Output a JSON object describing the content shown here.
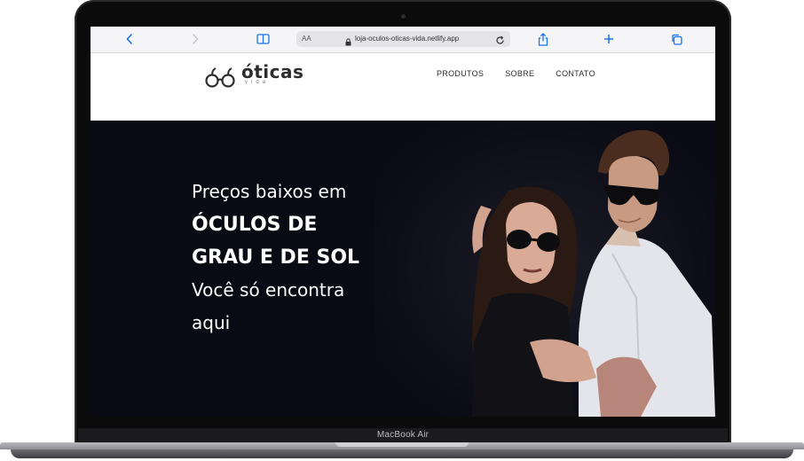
{
  "device": {
    "label": "MacBook Air"
  },
  "browser": {
    "aa_label": "AA",
    "url": "loja-oculos-oticas-vida.netlify.app",
    "icons": [
      "chevron-left-icon",
      "chevron-right-icon",
      "book-icon",
      "lock-icon",
      "reload-icon",
      "share-icon",
      "plus-icon",
      "tabs-icon"
    ],
    "accent": "#1a73e8"
  },
  "site": {
    "logo": {
      "name": "óticas",
      "sub": "vida"
    },
    "nav": [
      "PRODUTOS",
      "SOBRE",
      "CONTATO"
    ]
  },
  "hero": {
    "line1": "Preços baixos em",
    "line2": "ÓCULOS DE",
    "line3": "GRAU E DE SOL",
    "line4": "Você só encontra",
    "line5": "aqui",
    "background": "#090a13"
  }
}
